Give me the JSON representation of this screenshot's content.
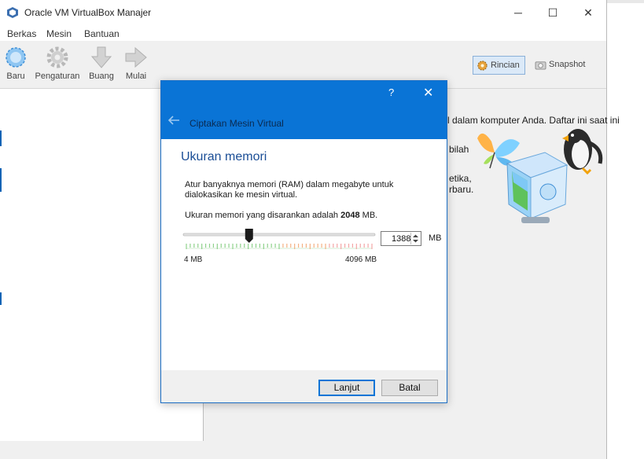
{
  "window": {
    "title": "Oracle VM VirtualBox Manajer",
    "controls": [
      "─",
      "☐",
      "✕"
    ]
  },
  "menu": [
    "Berkas",
    "Mesin",
    "Bantuan"
  ],
  "toolbar": {
    "buttons": [
      {
        "label": "Baru",
        "icon": "new-sparkle-icon"
      },
      {
        "label": "Pengaturan",
        "icon": "gear-icon"
      },
      {
        "label": "Buang",
        "icon": "down-arrow-icon"
      },
      {
        "label": "Mulai",
        "icon": "right-arrow-icon"
      }
    ],
    "rincian": "Rincian",
    "snapshot": "Snapshot"
  },
  "welcome": {
    "lines": [
      "l dalam komputer Anda. Daftar ini saat ini",
      "bilah",
      "etika,",
      "rbaru."
    ]
  },
  "dialog": {
    "help": "?",
    "close": "✕",
    "title": "Ciptakan Mesin Virtual",
    "heading": "Ukuran memori",
    "description": "Atur banyaknya memori (RAM) dalam megabyte untuk dialokasikan ke mesin virtual.",
    "recommend_prefix": "Ukuran memori yang disarankan adalah ",
    "recommend_value": "2048",
    "recommend_suffix": " MB.",
    "memory_value": "1388",
    "unit": "MB",
    "range_min": "4 MB",
    "range_max": "4096 MB",
    "slider_fraction": 0.338,
    "green_fraction": 0.5,
    "orange_fraction": 0.25,
    "next_label": "Lanjut",
    "cancel_label": "Batal"
  },
  "colors": {
    "accent": "#0a74d6",
    "heading": "#1b4e96",
    "ok_ticks": "#8fd18c",
    "warn_ticks": "#f4b183",
    "bad_ticks": "#f3a6a6"
  }
}
